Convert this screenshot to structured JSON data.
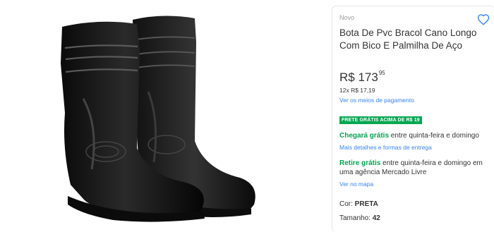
{
  "product": {
    "condition": "Novo",
    "title": "Bota De Pvc Bracol Cano Longo Com Bico E Palmilha De Aço",
    "price_main": "R$ 173",
    "price_cents": "95",
    "installments": "12x R$ 17,19",
    "payment_link": "Ver os meios de pagamento",
    "free_shipping_badge": "FRETE GRÁTIS ACIMA DE R$ 19",
    "shipping_highlight": "Chegará grátis",
    "shipping_text": " entre quinta-feira e domingo",
    "shipping_link": "Mais detalhes e formas de entrega",
    "pickup_highlight": "Retire grátis",
    "pickup_text": " entre quinta-feira e domingo em uma agência Mercado Livre",
    "map_link": "Ver no mapa",
    "color_label": "Cor: ",
    "color_value": "PRETA",
    "size_label": "Tamanho: ",
    "size_value": "42"
  },
  "icons": {
    "favorite": "heart-icon"
  },
  "colors": {
    "accent": "#3483fa",
    "green": "#00a650"
  }
}
